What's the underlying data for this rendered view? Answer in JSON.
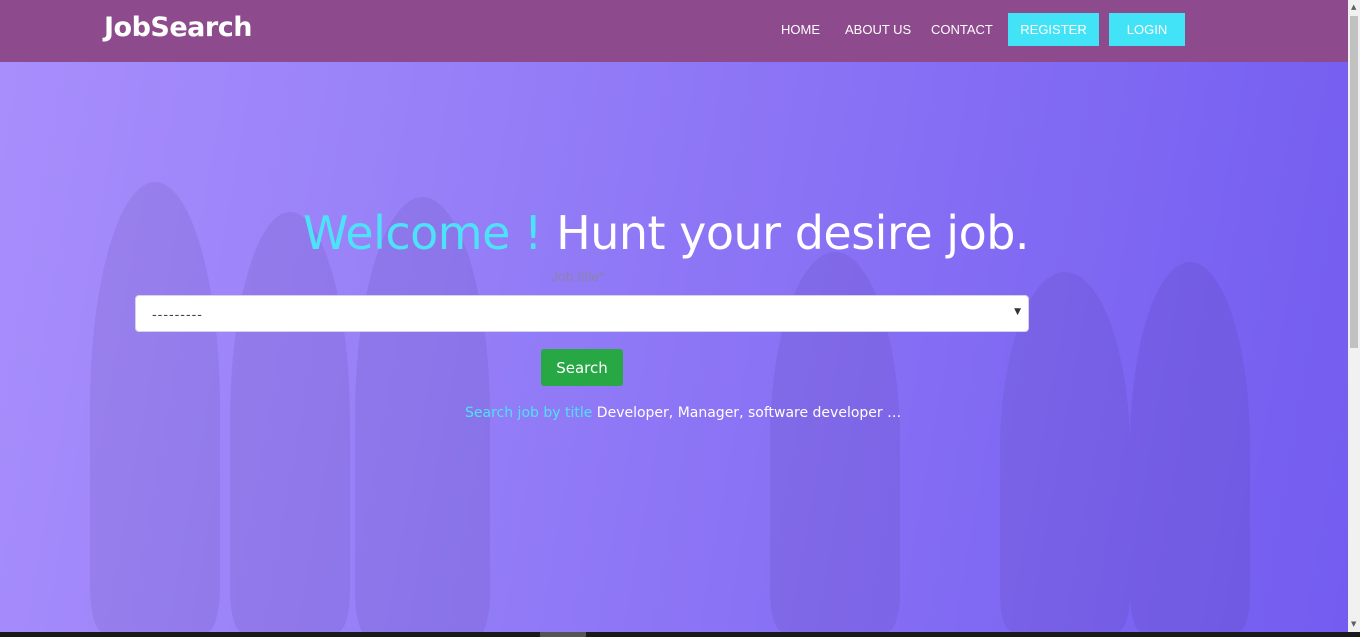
{
  "navbar": {
    "brand": "JobSearch",
    "links": [
      "HOME",
      "ABOUT US",
      "CONTACT"
    ],
    "register_label": "REGISTER",
    "login_label": "LOGIN"
  },
  "hero": {
    "headline_accent": "Welcome !",
    "headline_main": "Hunt your desire job.",
    "job_title_label": "Job title*",
    "job_title_selected": "---------",
    "search_label": "Search",
    "hint_accent": "Search job by title",
    "hint_examples": "Developer, Manager, software developer …"
  },
  "colors": {
    "navbar": "#8d4a8c",
    "accent_cyan": "#43e3f7",
    "search_green": "#28a745",
    "hero_purple": "#7b62f0"
  }
}
